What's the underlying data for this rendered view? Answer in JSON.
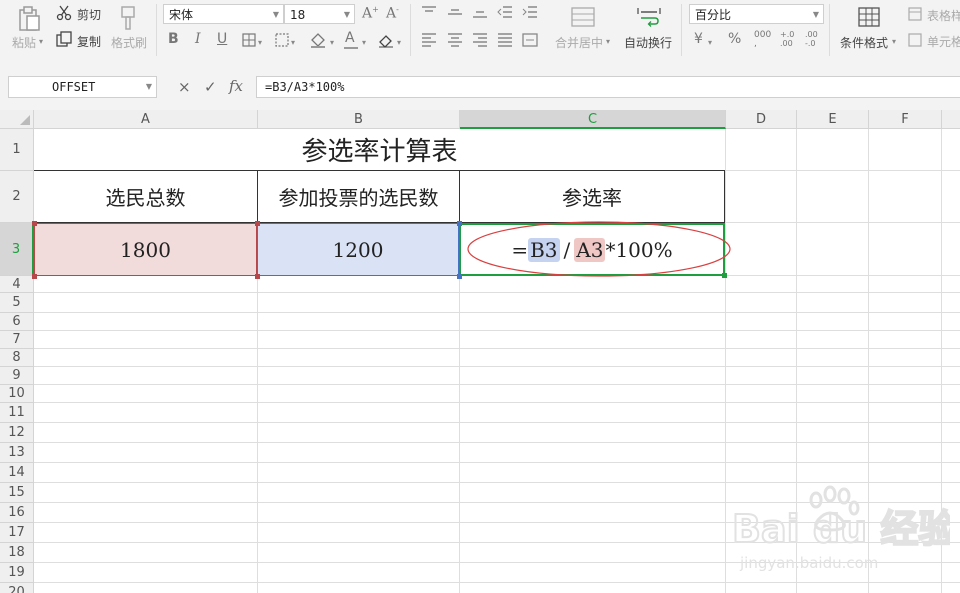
{
  "ribbon": {
    "paste": "粘贴",
    "cut": "剪切",
    "copy": "复制",
    "format_painter": "格式刷",
    "font_name": "宋体",
    "font_size": "18",
    "merge_center": "合并居中",
    "wrap_text": "自动换行",
    "number_format": "百分比",
    "conditional_format": "条件格式",
    "table_style": "表格样",
    "cell_style": "单元格"
  },
  "formula_bar": {
    "name_box": "OFFSET",
    "cancel_icon": "×",
    "confirm_icon": "✓",
    "fx_icon": "fx",
    "formula": "=B3/A3*100%"
  },
  "columns": [
    "A",
    "B",
    "C",
    "D",
    "E",
    "F"
  ],
  "rows": [
    "1",
    "2",
    "3",
    "4",
    "5",
    "6",
    "7",
    "8",
    "9",
    "10",
    "11",
    "12",
    "13",
    "14",
    "15",
    "16",
    "17",
    "18",
    "19",
    "20"
  ],
  "sheet": {
    "title": "参选率计算表",
    "headers": [
      "选民总数",
      "参加投票的选民数",
      "参选率"
    ],
    "a3": "1800",
    "b3": "1200",
    "c3": {
      "eq": "=",
      "ref1": "B3",
      "op": "/",
      "ref2": "A3",
      "tail": "*100%"
    }
  },
  "colors": {
    "selection_green": "#1f9e3f",
    "ref_blue": "#4472c4",
    "ref_red": "#b6474a",
    "annotation_red": "#d94040"
  },
  "watermark": {
    "brand": "Bai du 经验",
    "url": "jingyan.baidu.com"
  }
}
